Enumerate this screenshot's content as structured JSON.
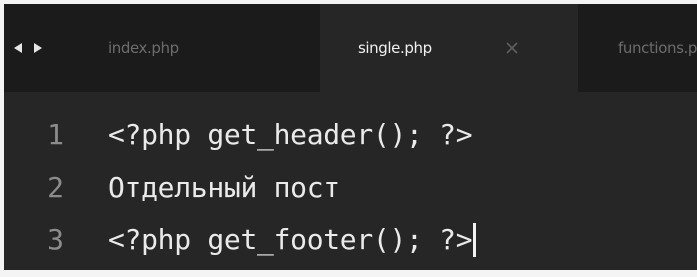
{
  "tabs": [
    {
      "label": "index.php",
      "active": false
    },
    {
      "label": "single.php",
      "active": true
    },
    {
      "label": "functions.php",
      "active": false
    }
  ],
  "navigation": {
    "back_icon": "triangle-left-icon",
    "forward_icon": "triangle-right-icon"
  },
  "close_icon": "close-icon",
  "editor": {
    "lines": [
      {
        "number": "1",
        "text": "<?php get_header(); ?>"
      },
      {
        "number": "2",
        "text": "Отдельный пост"
      },
      {
        "number": "3",
        "text": "<?php get_footer(); ?>"
      }
    ]
  },
  "colors": {
    "tab_bar": "#1b1b1b",
    "editor_background": "#262626",
    "text": "#eaeaea",
    "line_numbers": "#8c8c8c",
    "inactive_tab_text": "#6c6c6c"
  }
}
